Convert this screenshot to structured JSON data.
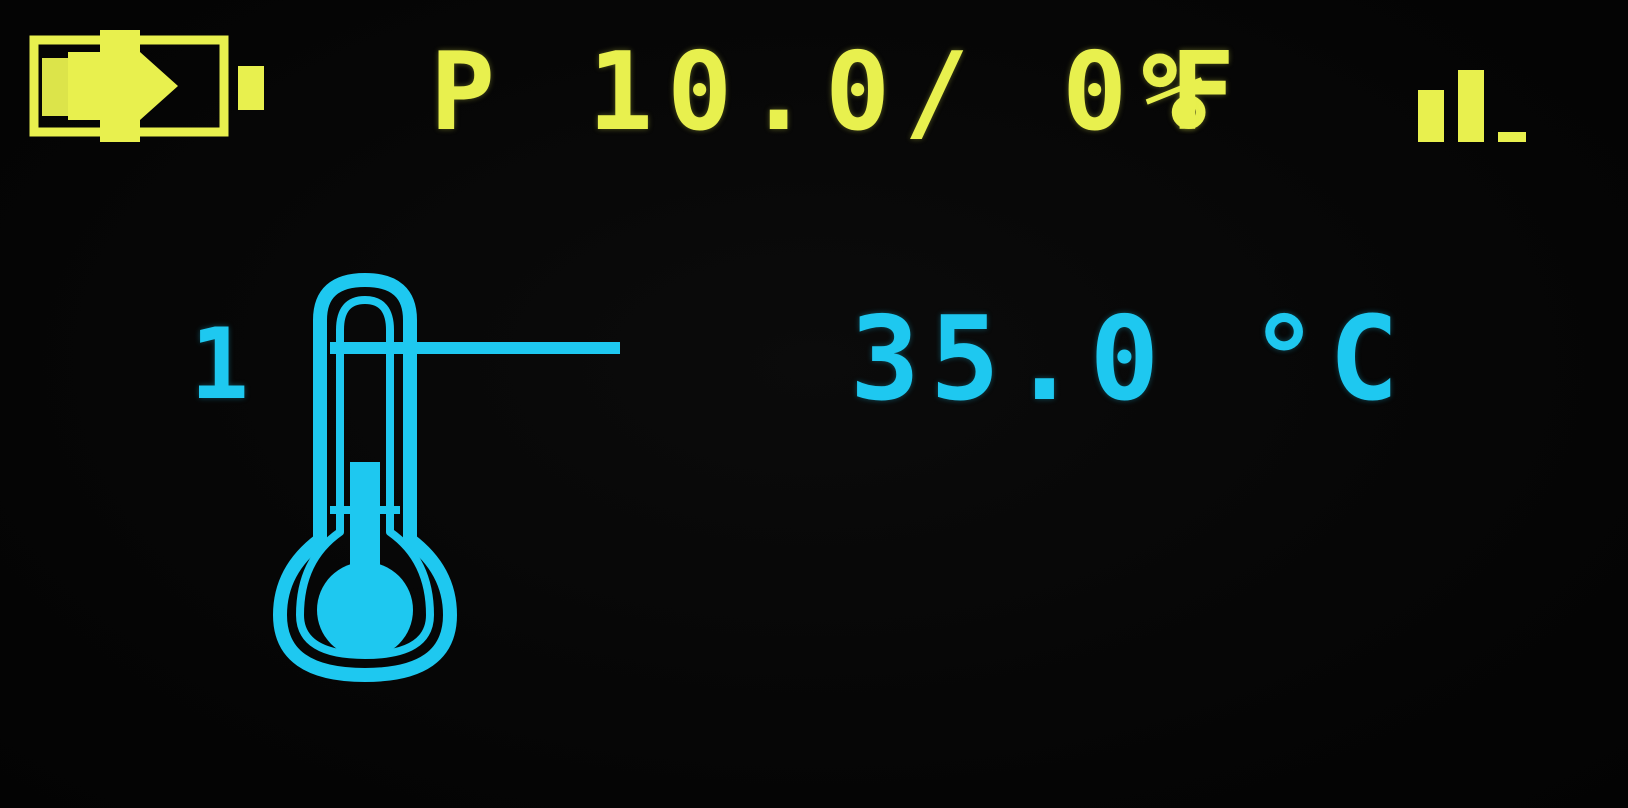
{
  "colors": {
    "status_bar": "#e8f04e",
    "main": "#1ec8f0",
    "background": "#050505"
  },
  "status_bar": {
    "battery_icon": "battery-charging-icon",
    "power_readout": "P 10.0/ 0%",
    "mode": "F",
    "signal_icon": "signal-strength-icon",
    "battery_level": 0.5,
    "signal_bars_active": 2,
    "signal_bars_total": 3
  },
  "main": {
    "sensor_number": "1",
    "thermometer_icon": "thermometer-icon",
    "thermometer_fill": 0.45,
    "temperature": "35.0 °C"
  }
}
